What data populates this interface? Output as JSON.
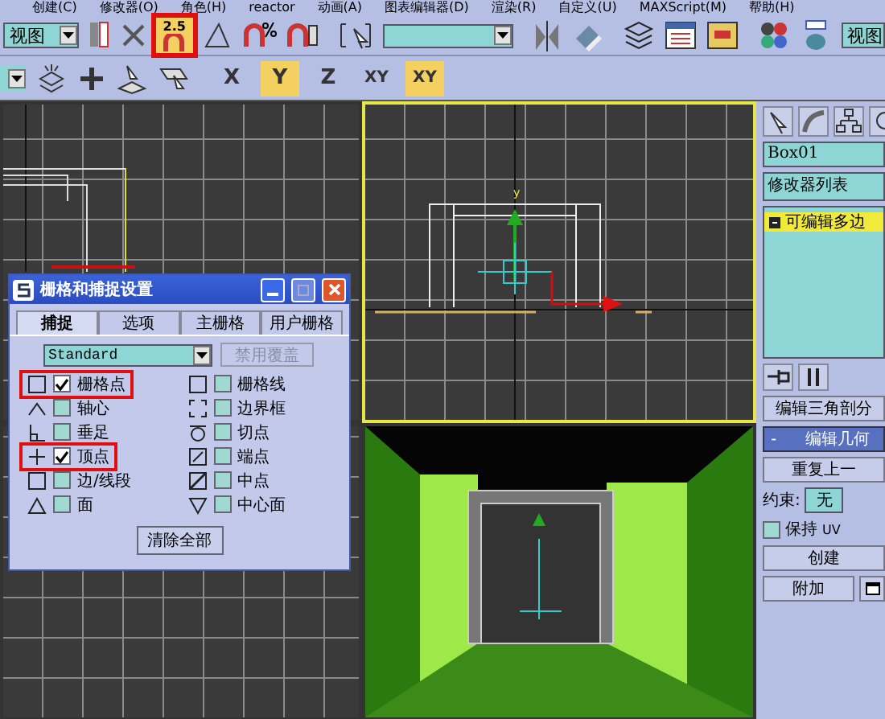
{
  "menu": [
    "创建(C)",
    "修改器(O)",
    "角色(H)",
    "reactor",
    "动画(A)",
    "图表编辑器(D)",
    "渲染(R)",
    "自定义(U)",
    "MAXScript(M)",
    "帮助(H)"
  ],
  "toolbar": {
    "view_dropdown": "视图",
    "snap_button": {
      "label": "2.5",
      "selected": true,
      "highlighted": true
    },
    "view_dropdown_right": "视图"
  },
  "axis_buttons": [
    {
      "label": "X",
      "selected": false
    },
    {
      "label": "Y",
      "selected": true
    },
    {
      "label": "Z",
      "selected": false
    },
    {
      "label": "XY",
      "selected": false
    },
    {
      "label": "XY",
      "selected": true
    }
  ],
  "viewports": [
    {
      "kind": "left",
      "active": false
    },
    {
      "kind": "top",
      "active": true,
      "axis_label": "y"
    },
    {
      "kind": "grid",
      "active": false
    },
    {
      "kind": "perspective",
      "active": false
    }
  ],
  "dialog": {
    "title": "栅格和捕捉设置",
    "tabs": [
      {
        "label": "捕捉",
        "selected": true
      },
      {
        "label": "选项",
        "selected": false
      },
      {
        "label": "主栅格",
        "selected": false
      },
      {
        "label": "用户栅格",
        "selected": false
      }
    ],
    "preset": "Standard",
    "override_button": {
      "label": "禁用覆盖",
      "disabled": true
    },
    "snaps_left": [
      {
        "kind": "grid-point",
        "label": "栅格点",
        "checked": true,
        "highlighted": true
      },
      {
        "kind": "pivot",
        "label": "轴心",
        "checked": false,
        "highlighted": false
      },
      {
        "kind": "perpendicular",
        "label": "垂足",
        "checked": false,
        "highlighted": false
      },
      {
        "kind": "vertex",
        "label": "顶点",
        "checked": true,
        "highlighted": true
      },
      {
        "kind": "edge",
        "label": "边/线段",
        "checked": false,
        "highlighted": false
      },
      {
        "kind": "face",
        "label": "面",
        "checked": false,
        "highlighted": false
      }
    ],
    "snaps_right": [
      {
        "kind": "grid-line",
        "label": "栅格线",
        "checked": false,
        "highlighted": false
      },
      {
        "kind": "bounding-box",
        "label": "边界框",
        "checked": false,
        "highlighted": false
      },
      {
        "kind": "tangent",
        "label": "切点",
        "checked": false,
        "highlighted": false
      },
      {
        "kind": "endpoint",
        "label": "端点",
        "checked": false,
        "highlighted": false
      },
      {
        "kind": "midpoint",
        "label": "中点",
        "checked": false,
        "highlighted": false
      },
      {
        "kind": "center-face",
        "label": "中心面",
        "checked": false,
        "highlighted": false
      }
    ],
    "clear_button": "清除全部"
  },
  "command_panel": {
    "object_name": "Box01",
    "modifier_list": "修改器列表",
    "stack_item": "可编辑多边",
    "retriangulate_button": "编辑三角剖分",
    "rollout": {
      "toggle": "-",
      "title": "编辑几何"
    },
    "repeat_button": "重复上一",
    "constraint_label": "约束:",
    "constraint_value": "无",
    "preserve_uv": {
      "label": "保持",
      "suffix": "UV",
      "checked": false
    },
    "create_button": "创建",
    "attach_button": "附加"
  }
}
